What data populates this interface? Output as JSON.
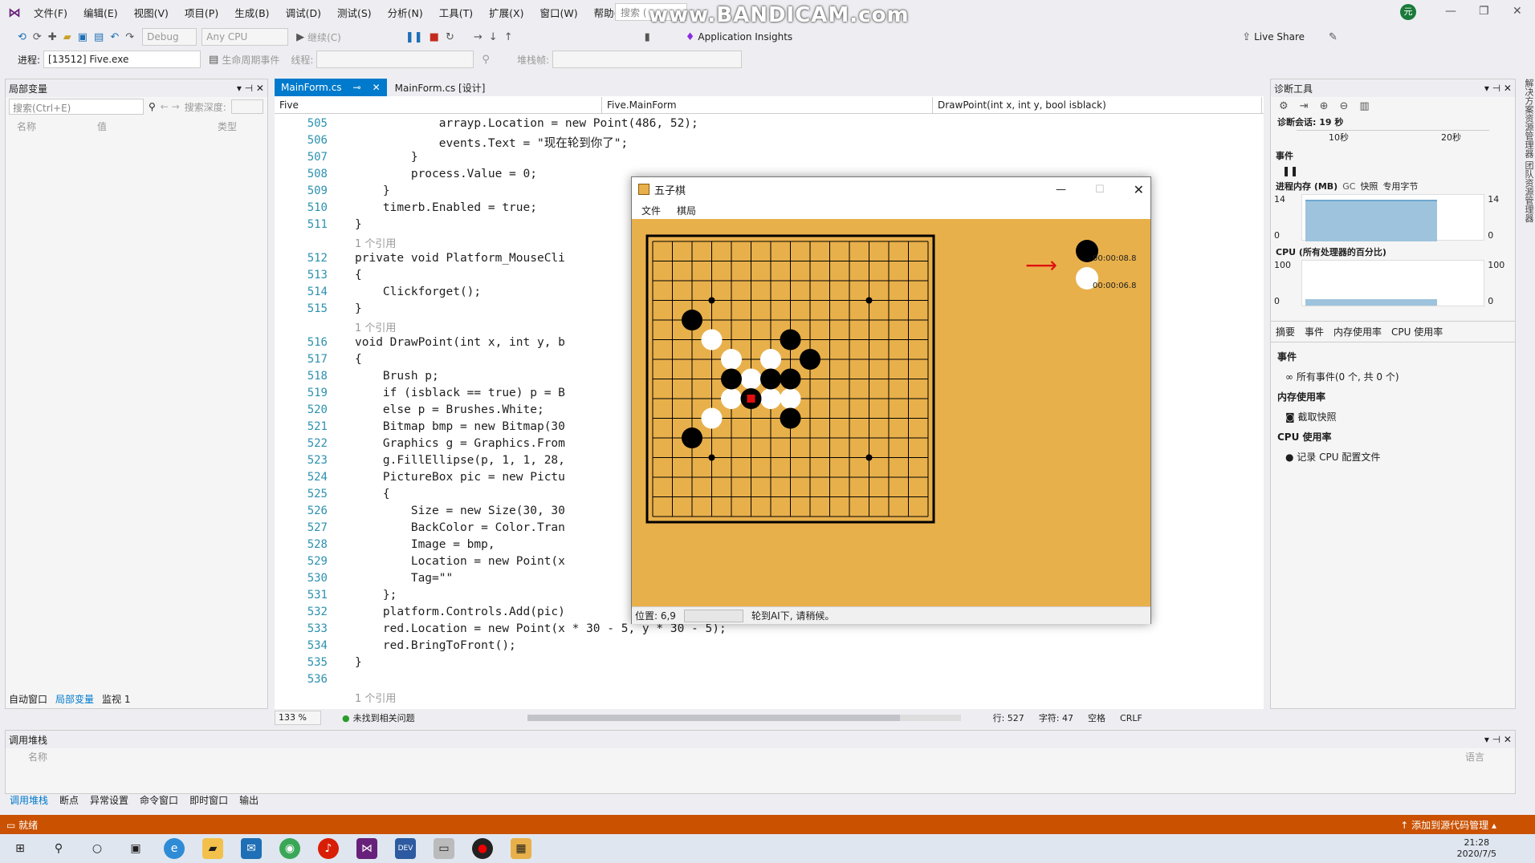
{
  "menubar": {
    "items": [
      "文件(F)",
      "编辑(E)",
      "视图(V)",
      "项目(P)",
      "生成(B)",
      "调试(D)",
      "测试(S)",
      "分析(N)",
      "工具(T)",
      "扩展(X)",
      "窗口(W)",
      "帮助(H)"
    ],
    "search": "搜索 (",
    "watermark": "www.BANDICAM.com",
    "avatar": "元"
  },
  "toolbar": {
    "config": "Debug",
    "platform": "Any CPU",
    "continue": "继续(C)",
    "app_insights": "Application Insights",
    "live_share": "Live Share",
    "process_label": "进程:",
    "process": "[13512] Five.exe",
    "lifecycle": "生命周期事件",
    "thread_label": "线程:",
    "stackframe_label": "堆栈帧:"
  },
  "locals": {
    "title": "局部变量",
    "search_placeholder": "搜索(Ctrl+E)",
    "depth_label": "搜索深度:",
    "col_name": "名称",
    "col_value": "值",
    "col_type": "类型",
    "tabs": [
      "自动窗口",
      "局部变量",
      "监视 1"
    ]
  },
  "editor": {
    "tab1": "MainForm.cs",
    "tab2": "MainForm.cs [设计]",
    "nav1": "Five",
    "nav2": "Five.MainForm",
    "nav3": "DrawPoint(int x, int y, bool isblack)",
    "zoom": "133 %",
    "issues": "未找到相关问题",
    "line_info": "行: 527",
    "char_info": "字符: 47",
    "space": "空格",
    "eol": "CRLF"
  },
  "code_lines": [
    {
      "n": "505",
      "t": "            arrayp.Location = new Point(486, 52);"
    },
    {
      "n": "506",
      "t": "            events.Text = \"现在轮到你了\";"
    },
    {
      "n": "507",
      "t": "        }"
    },
    {
      "n": "508",
      "t": "        process.Value = 0;"
    },
    {
      "n": "509",
      "t": "    }"
    },
    {
      "n": "510",
      "t": "    timerb.Enabled = true;"
    },
    {
      "n": "511",
      "t": "}"
    },
    {
      "n": "",
      "t": "1 个引用",
      "ref": true
    },
    {
      "n": "512",
      "t": "private void Platform_MouseCli"
    },
    {
      "n": "513",
      "t": "{"
    },
    {
      "n": "514",
      "t": "    Clickforget();"
    },
    {
      "n": "515",
      "t": "}"
    },
    {
      "n": "",
      "t": "1 个引用",
      "ref": true
    },
    {
      "n": "516",
      "t": "void DrawPoint(int x, int y, b"
    },
    {
      "n": "517",
      "t": "{"
    },
    {
      "n": "518",
      "t": "    Brush p;"
    },
    {
      "n": "519",
      "t": "    if (isblack == true) p = B"
    },
    {
      "n": "520",
      "t": "    else p = Brushes.White;"
    },
    {
      "n": "521",
      "t": "    Bitmap bmp = new Bitmap(30"
    },
    {
      "n": "522",
      "t": "    Graphics g = Graphics.From"
    },
    {
      "n": "523",
      "t": "    g.FillEllipse(p, 1, 1, 28,"
    },
    {
      "n": "524",
      "t": "    PictureBox pic = new Pictu"
    },
    {
      "n": "525",
      "t": "    {"
    },
    {
      "n": "526",
      "t": "        Size = new Size(30, 30"
    },
    {
      "n": "527",
      "t": "        BackColor = Color.Tran"
    },
    {
      "n": "528",
      "t": "        Image = bmp,"
    },
    {
      "n": "529",
      "t": "        Location = new Point(x"
    },
    {
      "n": "530",
      "t": "        Tag=\"\""
    },
    {
      "n": "531",
      "t": "    };"
    },
    {
      "n": "532",
      "t": "    platform.Controls.Add(pic)"
    },
    {
      "n": "533",
      "t": "    red.Location = new Point(x * 30 - 5, y * 30 - 5);"
    },
    {
      "n": "534",
      "t": "    red.BringToFront();"
    },
    {
      "n": "535",
      "t": "}"
    },
    {
      "n": "536",
      "t": ""
    },
    {
      "n": "",
      "t": "1 个引用",
      "ref": true
    }
  ],
  "diag": {
    "title": "诊断工具",
    "session": "诊断会话: 19 秒",
    "t10": "10秒",
    "t20": "20秒",
    "events": "事件",
    "memory_title": "进程内存 (MB)",
    "gc": "GC",
    "snapshot": "快照",
    "private_bytes": "专用字节",
    "mem_max": "14",
    "mem_min": "0",
    "cpu_title": "CPU (所有处理器的百分比)",
    "cpu_max": "100",
    "cpu_min": "0",
    "tabs": [
      "摘要",
      "事件",
      "内存使用率",
      "CPU 使用率"
    ],
    "events_header": "事件",
    "all_events": "所有事件(0 个, 共 0 个)",
    "mem_header": "内存使用率",
    "take_snapshot": "截取快照",
    "cpu_header": "CPU 使用率",
    "record_cpu": "记录 CPU 配置文件",
    "side_labels": "解决方案资源管理器  团队资源管理器"
  },
  "callstack": {
    "title": "调用堆栈",
    "col_name": "名称",
    "col_lang": "语言",
    "tabs": [
      "调用堆栈",
      "断点",
      "异常设置",
      "命令窗口",
      "即时窗口",
      "输出"
    ]
  },
  "statusbar": {
    "ready": "就绪",
    "source_control": "添加到源代码管理"
  },
  "taskbar": {
    "time": "21:28",
    "date": "2020/7/5"
  },
  "gomoku": {
    "title": "五子棋",
    "menu": [
      "文件",
      "棋局"
    ],
    "black_time": "00:00:08.8",
    "white_time": "00:00:06.8",
    "position_label": "位置: 6,9",
    "status_msg": "轮到AI下, 请稍候。",
    "progress": 0.0,
    "grid_lines": 15,
    "black_stones": [
      [
        2,
        4
      ],
      [
        7,
        5
      ],
      [
        8,
        6
      ],
      [
        4,
        7
      ],
      [
        6,
        7
      ],
      [
        7,
        7
      ],
      [
        7,
        9
      ],
      [
        2,
        10
      ]
    ],
    "white_stones": [
      [
        3,
        5
      ],
      [
        4,
        6
      ],
      [
        6,
        6
      ],
      [
        5,
        7
      ],
      [
        4,
        8
      ],
      [
        6,
        8
      ],
      [
        7,
        8
      ],
      [
        3,
        9
      ]
    ],
    "last_move": [
      5,
      8
    ],
    "star_points": [
      [
        3,
        3
      ],
      [
        11,
        3
      ],
      [
        3,
        11
      ],
      [
        11,
        11
      ]
    ],
    "colors": {
      "board": "#e8b04b",
      "accent": "#007acc",
      "status": "#ca5100",
      "last": "#e01010"
    }
  }
}
